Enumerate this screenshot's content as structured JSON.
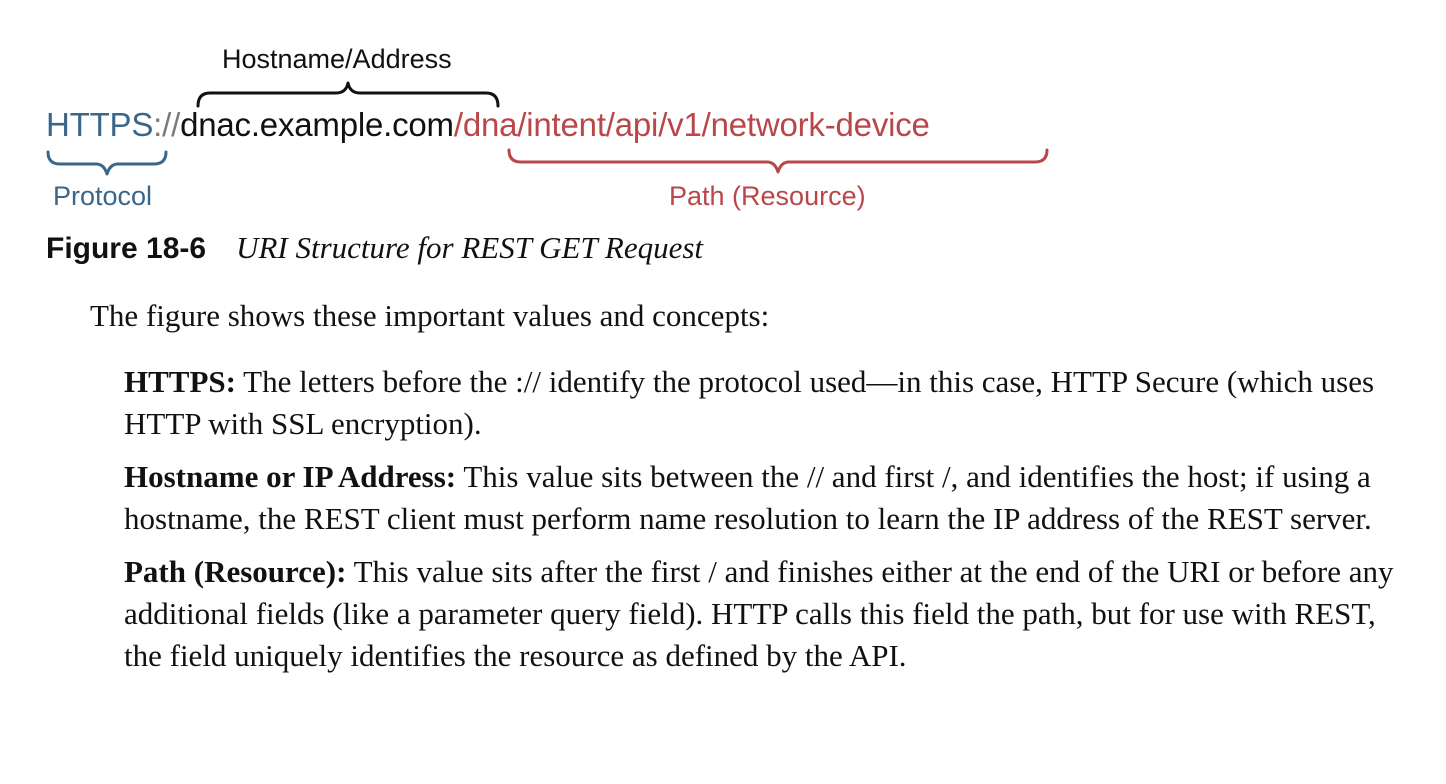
{
  "figure": {
    "labels": {
      "hostname": "Hostname/Address",
      "protocol": "Protocol",
      "path": "Path (Resource)"
    },
    "uri": {
      "protocol": "HTTPS",
      "separator": "://",
      "host": "dnac.example.com",
      "path": "/dna/intent/api/v1/network-device"
    },
    "colors": {
      "protocol": "#3a6689",
      "host": "#111111",
      "path": "#b9474a",
      "separator": "#7a7a7a"
    }
  },
  "caption": {
    "number": "Figure 18-6",
    "title": "URI Structure for REST GET Request"
  },
  "body": {
    "intro": "The figure shows these important values and concepts:",
    "items": [
      {
        "term": "HTTPS:",
        "text": " The letters before the :// identify the protocol used—in this case, HTTP Secure (which uses HTTP with SSL encryption)."
      },
      {
        "term": "Hostname or IP Address:",
        "text": " This value sits between the // and first /, and identifies the host; if using a hostname, the REST client must perform name resolution to learn the IP address of the REST server."
      },
      {
        "term": "Path (Resource):",
        "text": " This value sits after the first / and finishes either at the end of the URI or before any additional fields (like a parameter query field). HTTP calls this field the path, but for use with REST, the field uniquely identifies the resource as defined by the API."
      }
    ]
  }
}
